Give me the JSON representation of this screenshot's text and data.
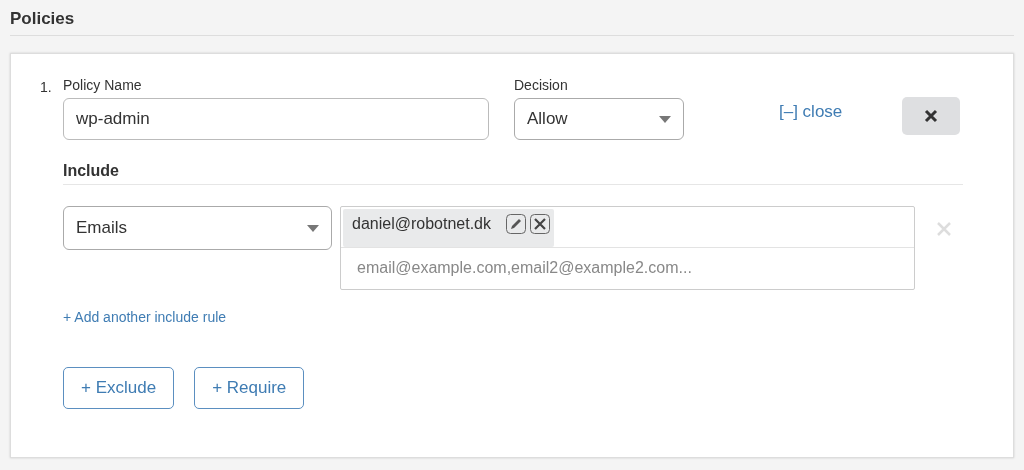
{
  "section_title": "Policies",
  "policies": [
    {
      "number": "1.",
      "name_label": "Policy Name",
      "name_value": "wp-admin",
      "decision_label": "Decision",
      "decision_value": "Allow",
      "collapse_link": "[–] close",
      "include": {
        "title": "Include",
        "rules": [
          {
            "type_value": "Emails",
            "tags": [
              "daniel@robotnet.dk"
            ],
            "placeholder": "email@example.com,email2@example2.com..."
          }
        ],
        "add_link": "+ Add another include rule"
      },
      "buttons": [
        "+ Exclude",
        "+ Require"
      ]
    }
  ]
}
